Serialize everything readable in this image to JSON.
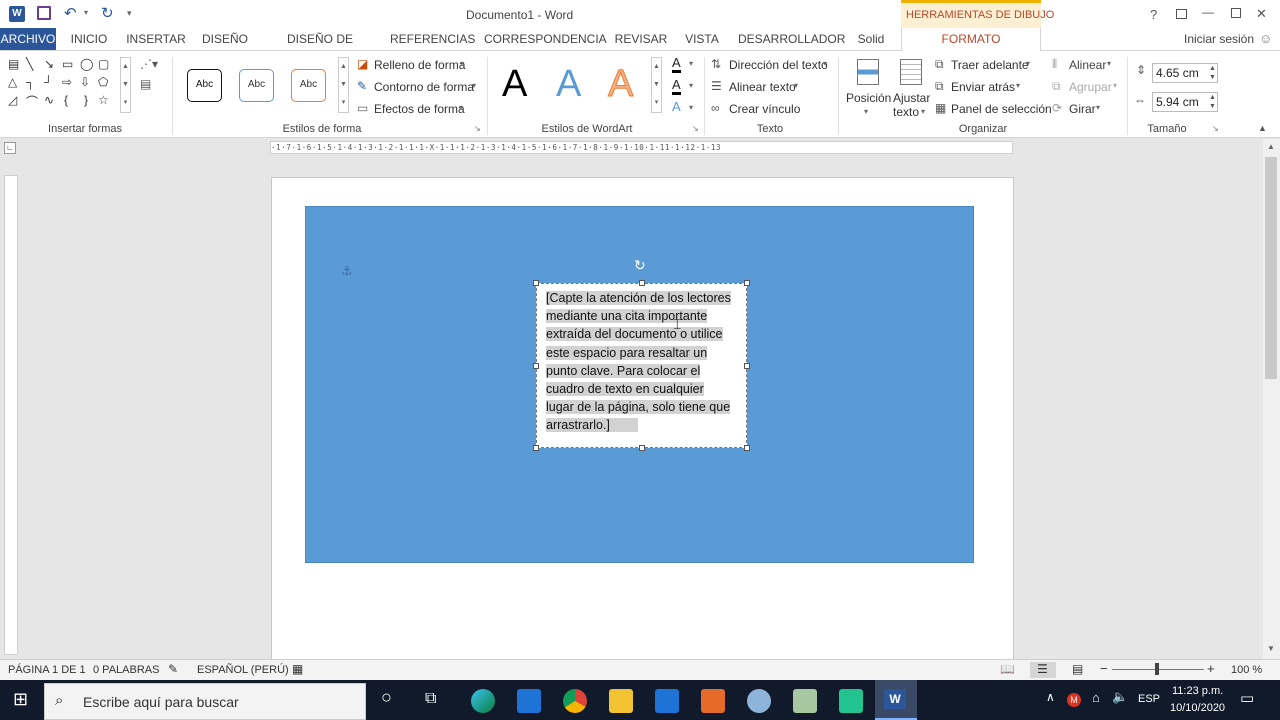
{
  "title_bar": {
    "doc_title": "Documento1 - Word",
    "tools_context": "HERRAMIENTAS DE DIBUJO",
    "help": "?",
    "minimize": "—",
    "close": "✕"
  },
  "tabs": [
    "ARCHIVO",
    "INICIO",
    "INSERTAR",
    "DISEÑO",
    "DISEÑO DE PÁGINA",
    "REFERENCIAS",
    "CORRESPONDENCIA",
    "REVISAR",
    "VISTA",
    "DESARROLLADOR",
    "Solid",
    "FORMATO"
  ],
  "signin": "Iniciar sesión",
  "ribbon": {
    "groups": {
      "insert_shapes": "Insertar formas",
      "shape_styles": "Estilos de forma",
      "wordart_styles": "Estilos de WordArt",
      "text": "Texto",
      "arrange": "Organizar",
      "size": "Tamaño"
    },
    "shape_style_samples": [
      "Abc",
      "Abc",
      "Abc"
    ],
    "shape_fill": "Relleno de forma",
    "shape_outline": "Contorno de forma",
    "shape_effects": "Efectos de forma",
    "wordart_letter": "A",
    "text_direction": "Dirección del texto",
    "align_text": "Alinear texto",
    "create_link": "Crear vínculo",
    "position": "Posición",
    "wrap_text_1": "Ajustar",
    "wrap_text_2": "texto",
    "bring_forward": "Traer adelante",
    "send_backward": "Enviar atrás",
    "selection_pane": "Panel de selección",
    "align": "Alinear",
    "group": "Agrupar",
    "rotate": "Girar",
    "height": "4.65 cm",
    "width": "5.94 cm"
  },
  "document": {
    "textbox_lines": [
      "[Capte la atención de los lectores",
      "mediante una cita importante",
      "extraída del documento o utilice",
      "este espacio para resaltar un",
      "punto clave. Para colocar el",
      "cuadro de texto en cualquier",
      "lugar de la página, solo tiene que",
      "arrastrarlo.]"
    ]
  },
  "status": {
    "page": "PÁGINA 1 DE 1",
    "words": "0 PALABRAS",
    "language": "ESPAÑOL (PERÚ)",
    "zoom": "100 %"
  },
  "taskbar": {
    "search_placeholder": "Escribe aquí para buscar",
    "lang": "ESP",
    "time": "11:23 p.m.",
    "date": "10/10/2020"
  },
  "colors": {
    "accent": "#2b579a",
    "context_tab": "#b7472a",
    "context_bg": "#fdf0d2",
    "shape_fill": "#5b9bd5",
    "taskbar": "#101a2a"
  }
}
